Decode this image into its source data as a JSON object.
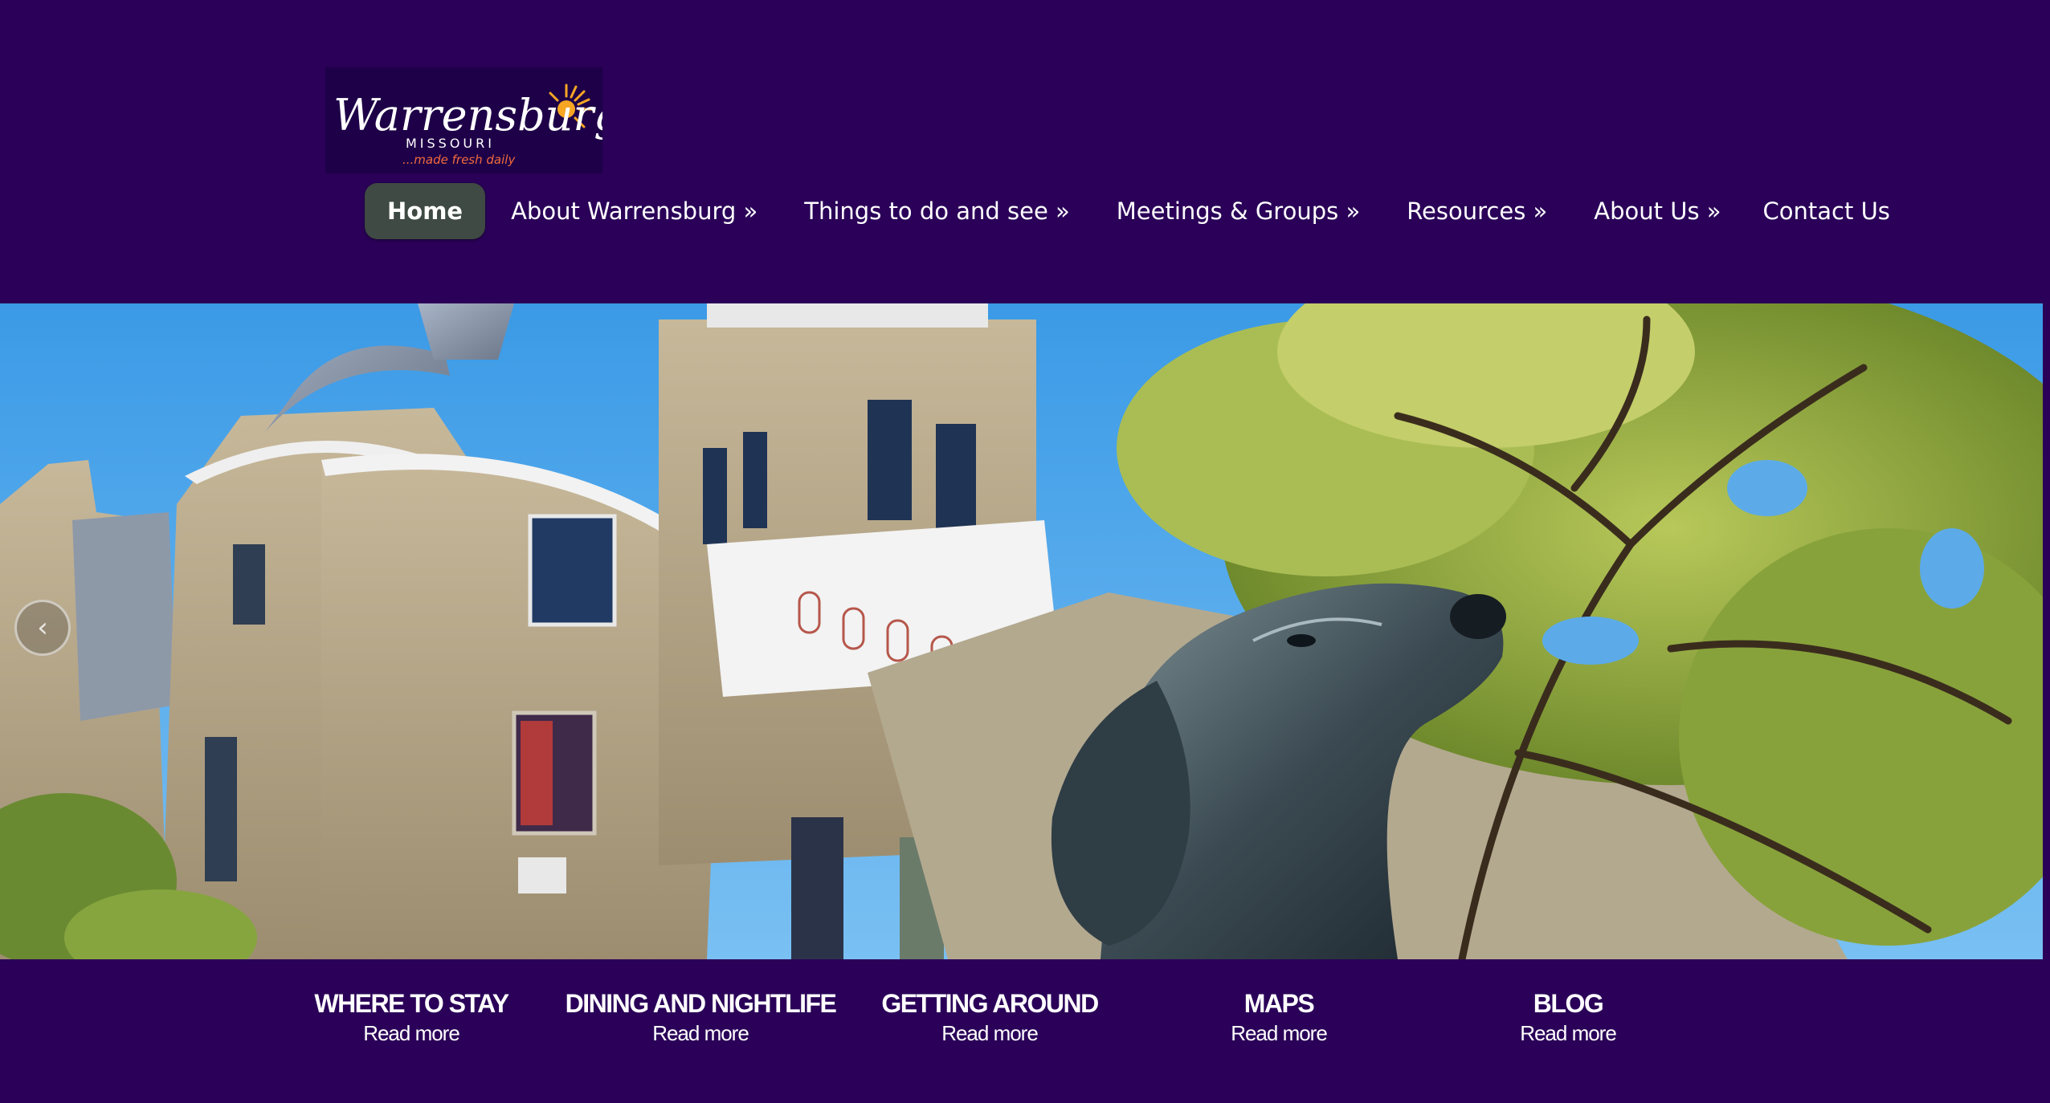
{
  "logo": {
    "name": "Warrensburg",
    "state": "MISSOURI",
    "tagline": "...made fresh daily"
  },
  "nav": {
    "items": [
      {
        "label": "Home"
      },
      {
        "label": "About Warrensburg »"
      },
      {
        "label": "Things to do and see »"
      },
      {
        "label": "Meetings & Groups »"
      },
      {
        "label": "Resources »"
      },
      {
        "label": "About Us »"
      },
      {
        "label": "Contact Us"
      }
    ]
  },
  "hero": {
    "arrow_icon": "chevron-left-icon"
  },
  "features": [
    {
      "title": "WHERE TO STAY",
      "link": "Read more"
    },
    {
      "title": "DINING AND NIGHTLIFE",
      "link": "Read more"
    },
    {
      "title": "GETTING AROUND",
      "link": "Read more"
    },
    {
      "title": "MAPS",
      "link": "Read more"
    },
    {
      "title": "BLOG",
      "link": "Read more"
    }
  ],
  "colors": {
    "background": "#2a0058",
    "home_button": "#3e4a43",
    "logo_accent": "#f6a623"
  }
}
